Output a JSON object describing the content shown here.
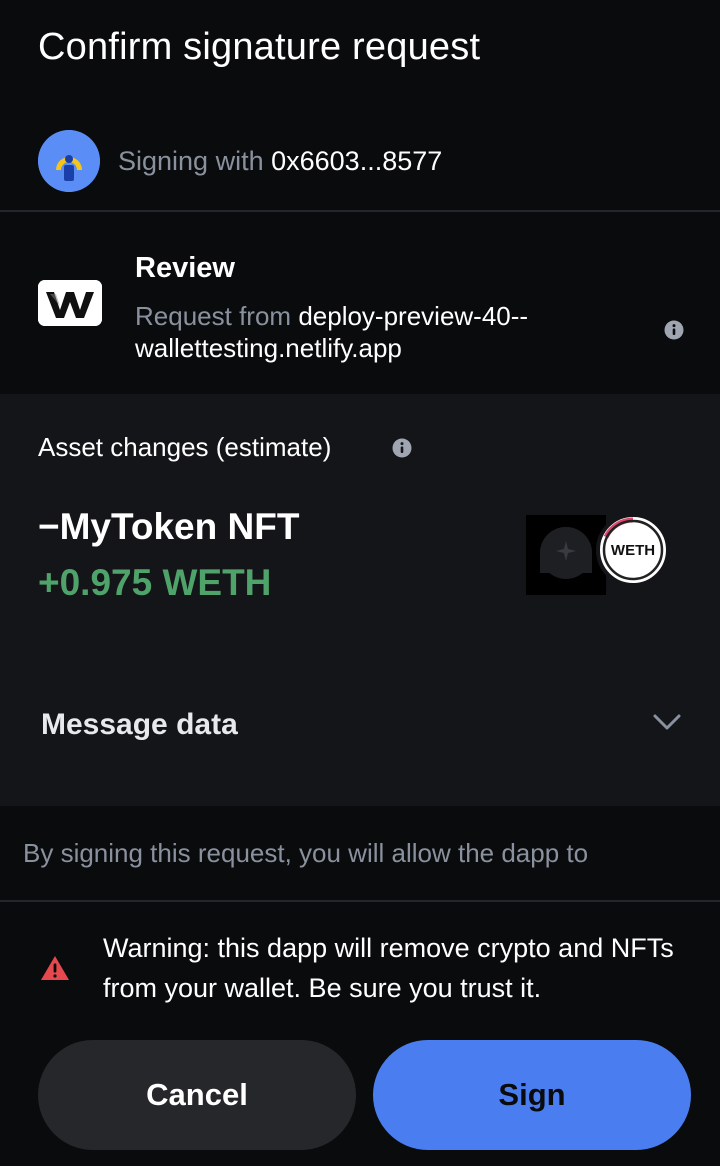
{
  "header": {
    "title": "Confirm signature request"
  },
  "signer": {
    "prefix": "Signing with",
    "address": "0x6603...8577",
    "avatar_icon": "person-avatar-icon"
  },
  "review": {
    "title": "Review",
    "request_prefix": "Request from",
    "host": "deploy-preview-40--wallettesting.netlify.app",
    "logo_icon": "dapp-w-logo-icon",
    "info_icon": "info-icon"
  },
  "asset_changes": {
    "label": "Asset changes (estimate)",
    "info_icon": "info-icon",
    "outgoing": "−MyToken NFT",
    "incoming": "+0.975 WETH",
    "nft_icon": "nft-thumbnail-icon",
    "token_symbol": "WETH",
    "incoming_color": "#4fa36a"
  },
  "message_data": {
    "label": "Message data",
    "toggle_icon": "chevron-down-icon"
  },
  "consent": {
    "text": "By signing this request, you will allow the dapp to"
  },
  "warning": {
    "icon": "warning-triangle-icon",
    "text": "Warning: this dapp will remove crypto and NFTs from your wallet. Be sure you trust it.",
    "icon_color": "#e5484d"
  },
  "actions": {
    "cancel_label": "Cancel",
    "sign_label": "Sign",
    "sign_color": "#4a7ef0"
  }
}
